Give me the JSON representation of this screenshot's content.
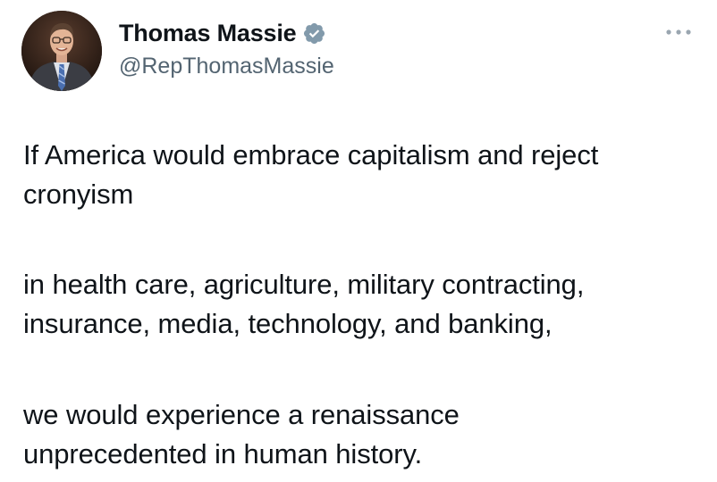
{
  "author": {
    "display_name": "Thomas Massie",
    "handle": "@RepThomasMassie",
    "verified": true,
    "verified_badge_color": "#829aab"
  },
  "icons": {
    "verified": "verified-badge-icon",
    "more": "more-options-icon",
    "avatar": "profile-photo"
  },
  "tweet": {
    "lines": [
      "If America would embrace capitalism and reject",
      "cronyism",
      "in health care, agriculture, military contracting,",
      "insurance, media, technology, and banking,",
      "we would experience a renaissance",
      "unprecedented in human history."
    ]
  },
  "colors": {
    "text_primary": "#0f1419",
    "text_secondary": "#536471",
    "background": "#ffffff"
  }
}
